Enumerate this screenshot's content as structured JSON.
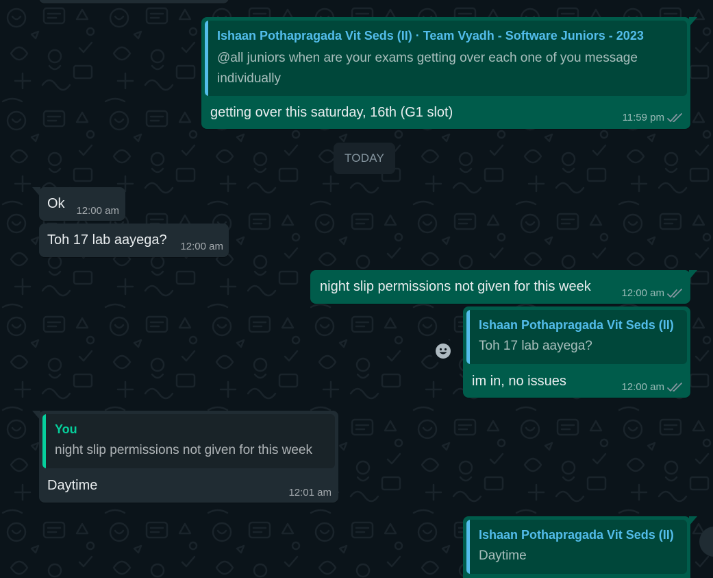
{
  "colors": {
    "background": "#0b141a",
    "outgoing_bubble": "#005c4b",
    "incoming_bubble": "#202c33",
    "quote_author_blue": "#53bdeb",
    "quote_author_you": "#06cf9c",
    "read_ticks": "#8696a0"
  },
  "messages": {
    "m1": {
      "quote_author": "Ishaan Pothapragada Vit Seds (II) · Team Vyadh - Software Juniors - 2023",
      "quote_text": "@all juniors when are your exams getting over each one of you message individually",
      "text": "getting over this saturday, 16th (G1 slot)",
      "time": "11:59 pm",
      "status_icon": "double-check-icon"
    },
    "date_divider": "TODAY",
    "m2": {
      "text": "Ok",
      "time": "12:00 am"
    },
    "m3": {
      "text": "Toh 17 lab aayega?",
      "time": "12:00 am"
    },
    "m4": {
      "text": "night slip permissions not given for this week",
      "time": "12:00 am",
      "status_icon": "double-check-icon"
    },
    "m5": {
      "quote_author": "Ishaan Pothapragada Vit Seds (II)",
      "quote_text": "Toh 17 lab aayega?",
      "text": "im in, no issues",
      "time": "12:00 am",
      "status_icon": "double-check-icon"
    },
    "m6": {
      "quote_author": "You",
      "quote_text": "night slip permissions not given for this week",
      "text": "Daytime",
      "time": "12:01 am"
    },
    "m7": {
      "quote_author": "Ishaan Pothapragada Vit Seds (II)",
      "quote_text": "Daytime"
    }
  },
  "reaction_button_icon": "smiley-icon"
}
